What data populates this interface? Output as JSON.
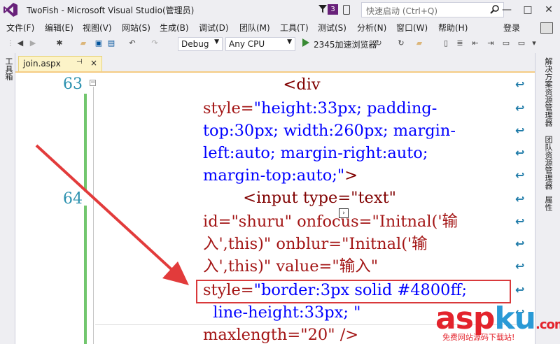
{
  "window": {
    "title": "TwoFish - Microsoft Visual Studio(管理员)",
    "notification_count": "3",
    "quick_launch_placeholder": "快速启动 (Ctrl+Q)",
    "min": "—",
    "max": "□",
    "close": "✕"
  },
  "menu": {
    "items": [
      "文件(F)",
      "编辑(E)",
      "视图(V)",
      "网站(S)",
      "生成(B)",
      "调试(D)",
      "团队(M)",
      "工具(T)",
      "测试(S)",
      "分析(N)",
      "窗口(W)",
      "帮助(H)"
    ],
    "login": "登录"
  },
  "toolbar": {
    "config": "Debug",
    "platform": "Any CPU",
    "browser": "2345加速浏览器"
  },
  "left_panel": {
    "toolbox": "工具箱"
  },
  "right_panel": {
    "solution_explorer": "解决方案资源管理器",
    "team_explorer": "团队资源管理器",
    "properties": "属性"
  },
  "tab": {
    "name": "join.aspx",
    "pin": "⊣",
    "close": "×"
  },
  "editor": {
    "line63": "63",
    "line64": "64",
    "lines": [
      [
        "",
        "",
        "                <div"
      ],
      [
        "style=",
        "\"height:33px; padding-",
        ""
      ],
      [
        "",
        "top:30px; width:260px; margin-",
        ""
      ],
      [
        "",
        "left:auto; margin-right:auto;",
        ""
      ],
      [
        "",
        "margin-top:auto;\"",
        ">"
      ],
      [
        "",
        "",
        "        <input type=\"text\""
      ],
      [
        "",
        "id=\"shuru\" onfocus=\"Initnal('输",
        ""
      ],
      [
        "",
        "入',this)\" onblur=\"Initnal('输",
        ""
      ],
      [
        "",
        "入',this)\" value=\"输入\"",
        ""
      ],
      [
        "style=",
        "\"border:3px solid #4800ff;",
        ""
      ],
      [
        "",
        "  line-height:33px; \"",
        ""
      ],
      [
        "",
        "maxlength=\"20\" />",
        ""
      ]
    ]
  },
  "watermark": {
    "main_a": "asp",
    "main_k": "ku",
    "tail": ".com",
    "sub": "免费网站源码下载站!"
  },
  "colors": {
    "accent": "#68217a",
    "highlight": "#d9393b",
    "arrow": "#e23b3b"
  }
}
